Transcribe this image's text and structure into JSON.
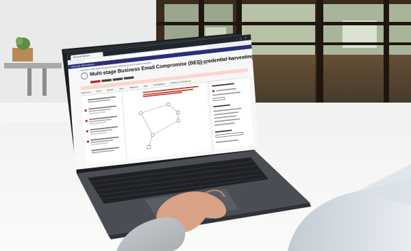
{
  "screen": {
    "browser_tab": "Microsoft 365 De...",
    "app_title": "Microsoft 365 Defender",
    "breadcrumb": "Incidents > Multi-stage incident involving Credential access & Lateral movement",
    "incident_title": "Multi-stage Business Email Compromise (BEC) credential harvesting incident",
    "actions": [
      "Manage incident",
      "Consult a threat expert",
      "Comments and history"
    ],
    "tabs": [
      "Attack story",
      "Alerts",
      "Devices",
      "Users",
      "Mailboxes",
      "Apps",
      "Investigations",
      "Evidence and Response"
    ]
  },
  "colors": {
    "title_bar": "#20262e",
    "app_bar": "#2b2f77",
    "severity_red": "#b5272e",
    "alert_banner": "#fbd6c9"
  }
}
